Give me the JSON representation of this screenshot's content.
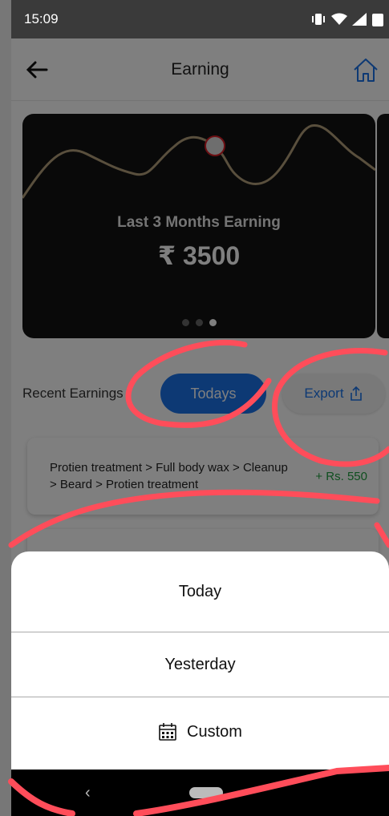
{
  "status_bar": {
    "time": "15:09"
  },
  "header": {
    "title": "Earning"
  },
  "hero": {
    "title": "Last 3 Months Earning",
    "amount": "₹ 3500"
  },
  "recent": {
    "label": "Recent Earnings",
    "todays_button": "Todays",
    "export_button": "Export"
  },
  "earnings": [
    {
      "services": "Protien treatment > Full body wax > Cleanup > Beard > Protien treatment",
      "amount": "+ Rs. 550"
    }
  ],
  "sheet": {
    "options": [
      "Today",
      "Yesterday",
      "Custom"
    ]
  },
  "colors": {
    "primary": "#1a73e8",
    "positive": "#1e9e3e",
    "annotation": "#ff4d5a"
  }
}
